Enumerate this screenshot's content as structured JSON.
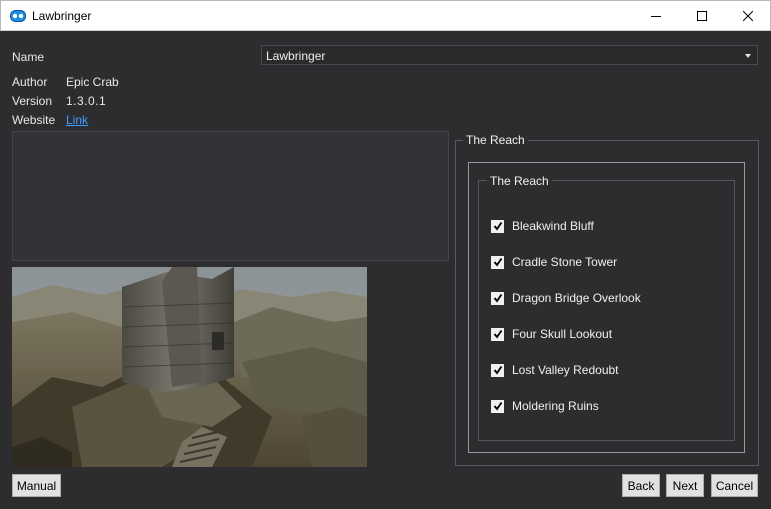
{
  "window": {
    "title": "Lawbringer",
    "controls": {
      "minimize": "minimize-icon",
      "maximize": "maximize-icon",
      "close": "close-icon"
    }
  },
  "info": {
    "name_label": "Name",
    "name_value": "Lawbringer",
    "author_label": "Author",
    "author_value": "Epic Crab",
    "version_label": "Version",
    "version_value": "1.3.0.1",
    "website_label": "Website",
    "website_link": "Link"
  },
  "options": {
    "outer_group_title": "The Reach",
    "inner_group_title": "The Reach",
    "items": [
      {
        "label": "Bleakwind Bluff",
        "checked": true
      },
      {
        "label": "Cradle Stone Tower",
        "checked": true
      },
      {
        "label": "Dragon Bridge Overlook",
        "checked": true
      },
      {
        "label": "Four Skull Lookout",
        "checked": true
      },
      {
        "label": "Lost Valley Redoubt",
        "checked": true
      },
      {
        "label": "Moldering Ruins",
        "checked": true
      }
    ]
  },
  "buttons": {
    "manual": "Manual",
    "back": "Back",
    "next": "Next",
    "cancel": "Cancel"
  },
  "colors": {
    "background": "#2d2d30",
    "link": "#3e9fff",
    "button_face": "#e1e1e1"
  }
}
